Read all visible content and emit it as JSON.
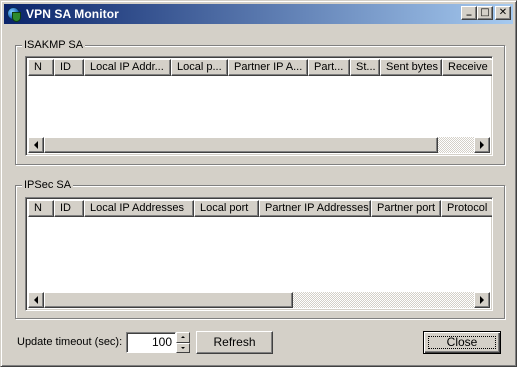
{
  "window": {
    "title": "VPN SA Monitor"
  },
  "title_buttons": {
    "minimize": "_",
    "maximize": "□",
    "close": "✕"
  },
  "isakmp": {
    "title": "ISAKMP SA",
    "columns": [
      "N",
      "ID",
      "Local IP Addr...",
      "Local p...",
      "Partner IP A...",
      "Part...",
      "St...",
      "Sent bytes",
      "Receive"
    ]
  },
  "ipsec": {
    "title": "IPSec SA",
    "columns": [
      "N",
      "ID",
      "Local IP Addresses",
      "Local port",
      "Partner IP Addresses",
      "Partner port",
      "Protocol"
    ]
  },
  "footer": {
    "timeout_label": "Update timeout (sec):",
    "timeout_value": "100",
    "refresh_label": "Refresh",
    "close_label": "Close"
  }
}
